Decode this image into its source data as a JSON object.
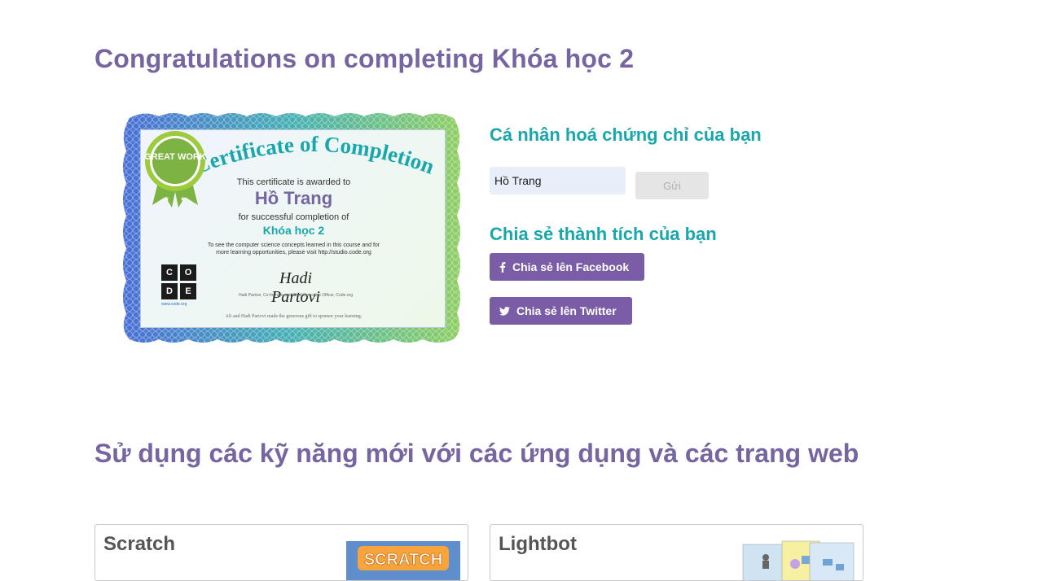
{
  "page": {
    "title": "Congratulations on completing Khóa học 2"
  },
  "certificate": {
    "heading": "Certificate of Completion",
    "awarded_to_text": "This certificate is awarded to",
    "recipient": "Hồ Trang",
    "for_text": "for successful completion of",
    "course": "Khóa học 2",
    "note": "To see the computer science concepts learned in this course and for more learning opportunities, please visit http://studio.code.org",
    "signature": "Hadi Partovi",
    "signature_caption": "Hadi Partovi, Co-founder and Chief Executive Officer, Code.org",
    "footer": "Ali and Hadi Partovi made the generous gift to sponsor your learning.",
    "logo_letters": [
      "C",
      "O",
      "D",
      "E"
    ],
    "logo_url": "www.code.org",
    "badge_text": "GREAT WORK"
  },
  "personalize": {
    "heading": "Cá nhân hoá chứng chỉ của bạn",
    "name_value": "Hồ Trang",
    "submit_label": "Gửi"
  },
  "share": {
    "heading": "Chia sẻ thành tích của bạn",
    "facebook_label": "Chia sẻ lên Facebook",
    "twitter_label": "Chia sẻ lên Twitter"
  },
  "apps": {
    "heading": "Sử dụng các kỹ năng mới với các ứng dụng và các trang web",
    "cards": [
      {
        "title": "Scratch",
        "thumb_text": "SCRATCH"
      },
      {
        "title": "Lightbot"
      }
    ]
  },
  "colors": {
    "title_purple": "#7665a0",
    "teal": "#19a7ad",
    "button_purple": "#7a5da6",
    "input_bg": "#e8effb"
  },
  "icons": {
    "facebook": "facebook-icon",
    "twitter": "twitter-icon"
  }
}
